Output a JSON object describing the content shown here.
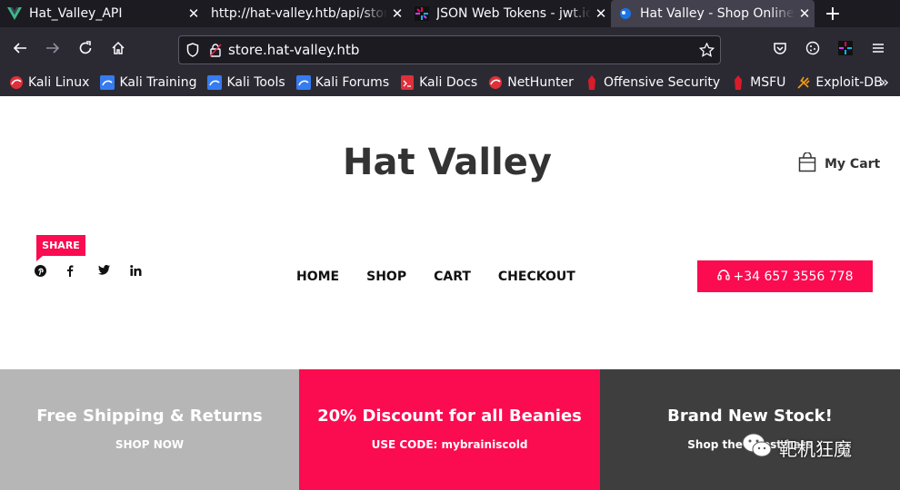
{
  "browser": {
    "tabs": [
      {
        "title": "Hat_Valley_API",
        "favicon": "vue-icon",
        "active": false
      },
      {
        "title": "http://hat-valley.htb/api/store-status",
        "favicon": "none",
        "active": false
      },
      {
        "title": "JSON Web Tokens - jwt.io",
        "favicon": "jwt-icon",
        "active": false
      },
      {
        "title": "Hat Valley - Shop Online!",
        "favicon": "store-icon",
        "active": true
      }
    ],
    "url": "store.hat-valley.htb",
    "bookmarks": [
      {
        "label": "Kali Linux",
        "icon": "kali-icon"
      },
      {
        "label": "Kali Training",
        "icon": "kali-training-icon"
      },
      {
        "label": "Kali Tools",
        "icon": "kali-tools-icon"
      },
      {
        "label": "Kali Forums",
        "icon": "kali-forums-icon"
      },
      {
        "label": "Kali Docs",
        "icon": "kali-docs-icon"
      },
      {
        "label": "NetHunter",
        "icon": "nethunter-icon"
      },
      {
        "label": "Offensive Security",
        "icon": "offsec-icon"
      },
      {
        "label": "MSFU",
        "icon": "msfu-icon"
      },
      {
        "label": "Exploit-DB",
        "icon": "exploitdb-icon"
      }
    ]
  },
  "site": {
    "title": "Hat Valley",
    "cart_label": "My Cart",
    "share_label": "SHARE",
    "menu": [
      "HOME",
      "SHOP",
      "CART",
      "CHECKOUT"
    ],
    "phone": "+34 657 3556 778",
    "banners": [
      {
        "heading": "Free Shipping & Returns",
        "sub": "SHOP NOW"
      },
      {
        "heading": "20% Discount for all Beanies",
        "sub": "USE CODE: mybrainiscold"
      },
      {
        "heading": "Brand New Stock!",
        "sub": "Shop the latest hats"
      }
    ],
    "watermark": "靶机狂魔"
  },
  "colors": {
    "accent": "#fb0b50",
    "banner_grey": "#b6b6b6",
    "banner_dark": "#3e3e3e"
  }
}
